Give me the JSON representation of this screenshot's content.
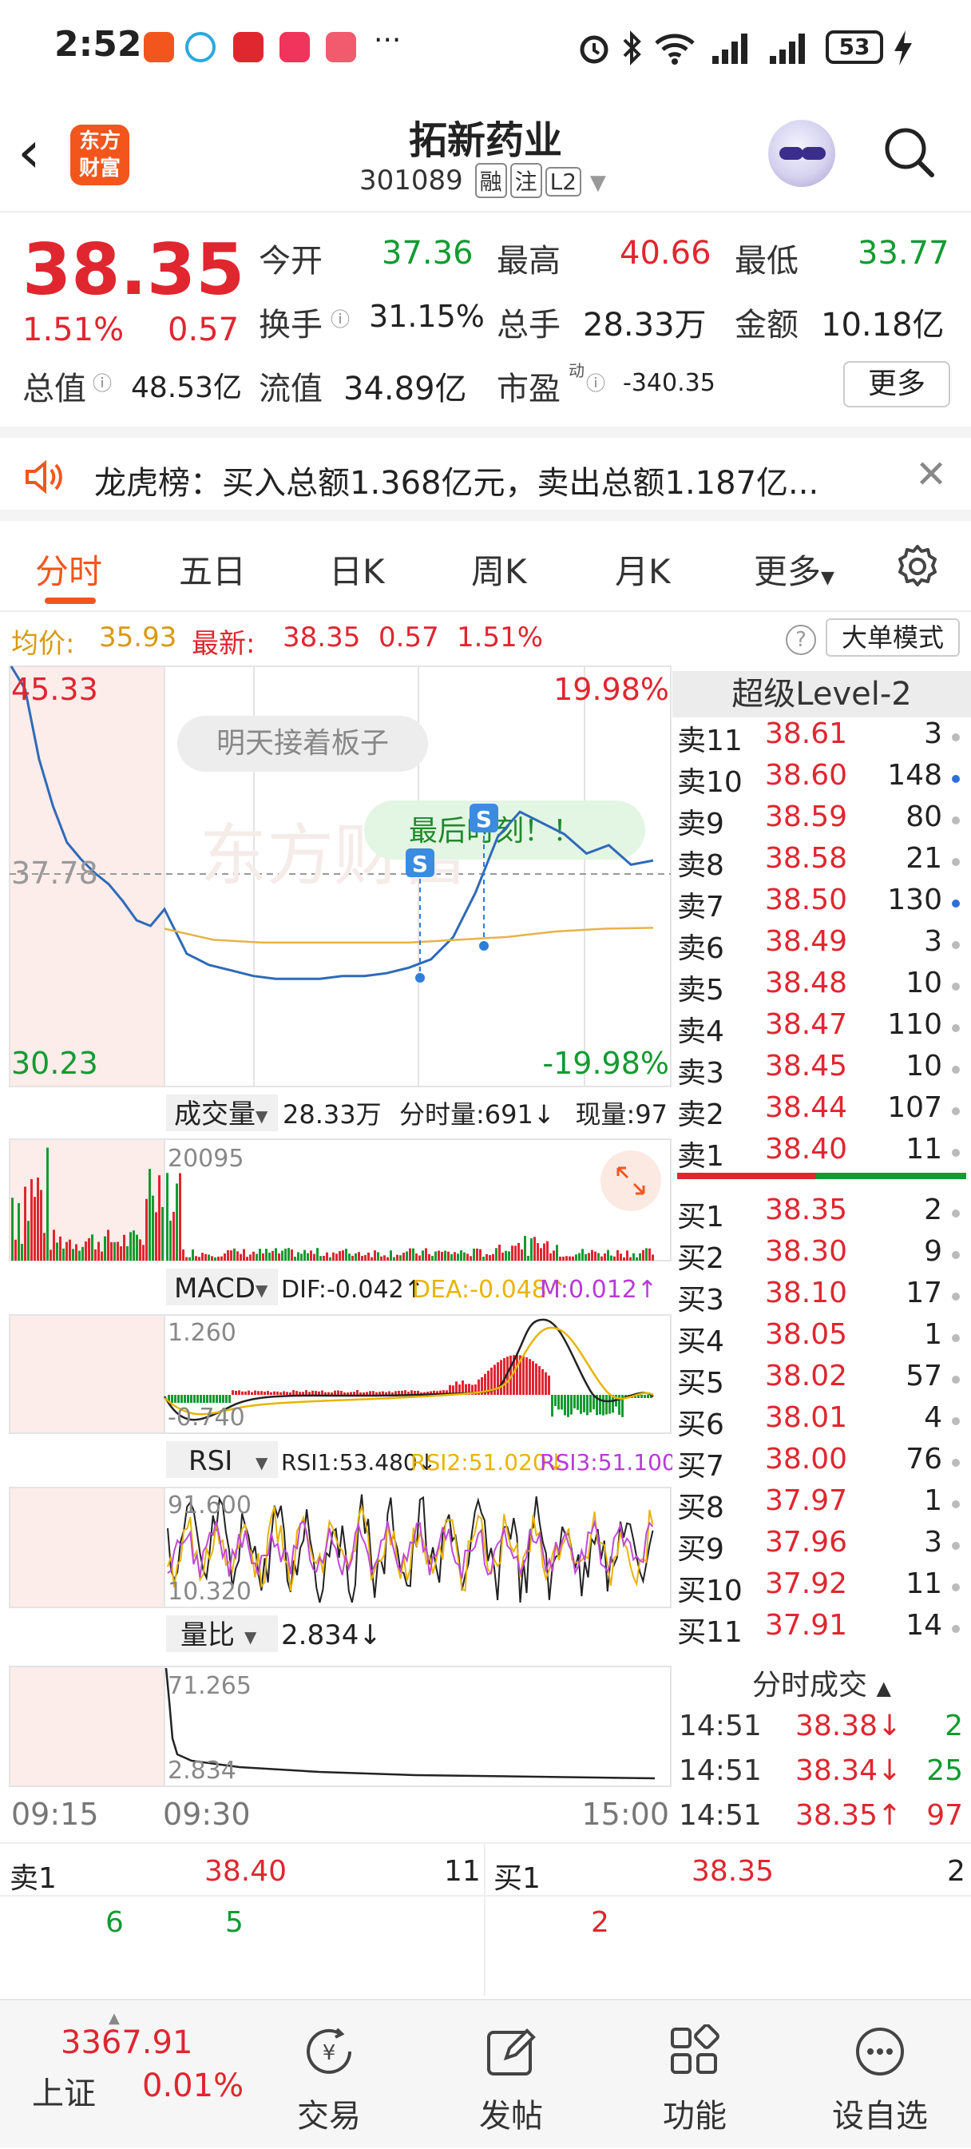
{
  "status_bar": {
    "time": "2:52",
    "battery": "53",
    "more": "···"
  },
  "header": {
    "logo": [
      "东方",
      "财富"
    ],
    "stock_name": "拓新药业",
    "code": "301089",
    "tags": [
      "融",
      "注",
      "L2"
    ]
  },
  "quote": {
    "last_price": "38.35",
    "change_pct": "1.51%",
    "change": "0.57",
    "fields": [
      {
        "label": "今开",
        "value": "37.36",
        "color": "green"
      },
      {
        "label": "最高",
        "value": "40.66",
        "color": "red"
      },
      {
        "label": "最低",
        "value": "33.77",
        "color": "green"
      },
      {
        "label": "换手",
        "value": "31.15%",
        "color": "dark"
      },
      {
        "label": "总手",
        "value": "28.33万",
        "color": "dark"
      },
      {
        "label": "金额",
        "value": "10.18亿",
        "color": "dark"
      },
      {
        "label": "总值",
        "value": "48.53亿",
        "color": "dark"
      },
      {
        "label": "流值",
        "value": "34.89亿",
        "color": "dark"
      },
      {
        "label": "市盈",
        "value": "-340.35",
        "color": "dark"
      }
    ],
    "pe_superscript": "动",
    "more_button": "更多"
  },
  "banner": {
    "text": "龙虎榜：买入总额1.368亿元，卖出总额1.187亿..."
  },
  "tabs": [
    "分时",
    "五日",
    "日K",
    "周K",
    "月K",
    "更多"
  ],
  "avg_line": {
    "avg_label": "均价:",
    "avg_value": "35.93",
    "latest_label": "最新:",
    "latest_value": "38.35",
    "change": "0.57",
    "pct": "1.51%",
    "help": "?",
    "big_order_button": "大单模式"
  },
  "chart": {
    "price_top": "45.33",
    "price_mid": "37.78",
    "price_bottom": "30.23",
    "pct_top": "19.98%",
    "pct_bottom": "-19.98%",
    "bubble_1": "明天接着板子",
    "bubble_2": "最后时刻！！",
    "watermark": "东方财富",
    "marker_s": "S",
    "volume_label": "成交量",
    "volume_total": "28.33万",
    "volume_tick": "分时量:691↓",
    "volume_now": "现量:97",
    "volume_max": "20095",
    "macd_label": "MACD",
    "macd_dif": "DIF:-0.042↑",
    "macd_dea": "DEA:-0.048↑",
    "macd_m": "M:0.012↑",
    "macd_top": "1.260",
    "macd_bottom": "-0.740",
    "rsi_label": "RSI",
    "rsi1": "RSI1:53.480↓",
    "rsi2": "RSI2:51.020↓",
    "rsi3": "RSI3:51.100↓",
    "rsi_top": "91.600",
    "rsi_bottom": "10.320",
    "lb_label": "量比",
    "lb_value": "2.834↓",
    "lb_top": "71.265",
    "lb_bottom": "2.834",
    "time_start": "09:15",
    "time_open": "09:30",
    "time_end": "15:00"
  },
  "chart_data": {
    "type": "line",
    "title": "",
    "ylim": [
      30.23,
      45.33
    ],
    "x": [
      "09:15",
      "09:30",
      "15:00"
    ],
    "series": [
      {
        "values": [
          45.33,
          44.5,
          42.0,
          40.3,
          39.0,
          38.4,
          37.9,
          37.5,
          36.9,
          36.2,
          36.0,
          36.6,
          35.0,
          34.6,
          34.4,
          34.2,
          34.1,
          34.1,
          34.1,
          34.2,
          34.2,
          34.3,
          34.5,
          34.8,
          35.6,
          37.2,
          39.2,
          40.1,
          39.7,
          39.3,
          38.6,
          38.9,
          38.2,
          38.35
        ]
      },
      {
        "values": [
          35.9,
          35.5,
          35.4,
          35.4,
          35.4,
          35.4,
          35.5,
          35.6,
          35.8,
          35.9,
          35.93
        ]
      }
    ]
  },
  "level2": {
    "title": "超级Level-2",
    "sells": [
      {
        "label": "卖11",
        "price": "38.61",
        "vol": "3",
        "dot": "#bbb"
      },
      {
        "label": "卖10",
        "price": "38.60",
        "vol": "148",
        "dot": "#2e6fd8"
      },
      {
        "label": "卖9",
        "price": "38.59",
        "vol": "80",
        "dot": "#bbb"
      },
      {
        "label": "卖8",
        "price": "38.58",
        "vol": "21",
        "dot": "#bbb"
      },
      {
        "label": "卖7",
        "price": "38.50",
        "vol": "130",
        "dot": "#2e6fd8"
      },
      {
        "label": "卖6",
        "price": "38.49",
        "vol": "3",
        "dot": "#bbb"
      },
      {
        "label": "卖5",
        "price": "38.48",
        "vol": "10",
        "dot": "#bbb"
      },
      {
        "label": "卖4",
        "price": "38.47",
        "vol": "110",
        "dot": "#bbb"
      },
      {
        "label": "卖3",
        "price": "38.45",
        "vol": "10",
        "dot": "#bbb"
      },
      {
        "label": "卖2",
        "price": "38.44",
        "vol": "107",
        "dot": "#bbb"
      },
      {
        "label": "卖1",
        "price": "38.40",
        "vol": "11",
        "dot": "#bbb"
      }
    ],
    "buys": [
      {
        "label": "买1",
        "price": "38.35",
        "vol": "2",
        "dot": "#bbb"
      },
      {
        "label": "买2",
        "price": "38.30",
        "vol": "9",
        "dot": "#bbb"
      },
      {
        "label": "买3",
        "price": "38.10",
        "vol": "17",
        "dot": "#bbb"
      },
      {
        "label": "买4",
        "price": "38.05",
        "vol": "1",
        "dot": "#bbb"
      },
      {
        "label": "买5",
        "price": "38.02",
        "vol": "57",
        "dot": "#bbb"
      },
      {
        "label": "买6",
        "price": "38.01",
        "vol": "4",
        "dot": "#bbb"
      },
      {
        "label": "买7",
        "price": "38.00",
        "vol": "76",
        "dot": "#bbb"
      },
      {
        "label": "买8",
        "price": "37.97",
        "vol": "1",
        "dot": "#bbb"
      },
      {
        "label": "买9",
        "price": "37.96",
        "vol": "3",
        "dot": "#bbb"
      },
      {
        "label": "买10",
        "price": "37.92",
        "vol": "11",
        "dot": "#bbb"
      },
      {
        "label": "买11",
        "price": "37.91",
        "vol": "14",
        "dot": "#bbb"
      }
    ],
    "trades_title": "分时成交",
    "trades": [
      {
        "time": "14:51",
        "price": "38.38↓",
        "vol": "2",
        "dir": "down"
      },
      {
        "time": "14:51",
        "price": "38.34↓",
        "vol": "25",
        "dir": "down"
      },
      {
        "time": "14:51",
        "price": "38.35↑",
        "vol": "97",
        "dir": "up"
      }
    ]
  },
  "bottom_quote": {
    "sell_label": "卖1",
    "sell_price": "38.40",
    "sell_vol": "11",
    "buy_label": "买1",
    "buy_price": "38.35",
    "buy_vol": "2",
    "sell_detail": [
      "6",
      "5"
    ],
    "buy_detail": [
      "2"
    ]
  },
  "nav": {
    "index_value": "3367.91",
    "index_name": "上证",
    "index_pct": "0.01%",
    "items": [
      "交易",
      "发帖",
      "功能",
      "设自选"
    ]
  }
}
